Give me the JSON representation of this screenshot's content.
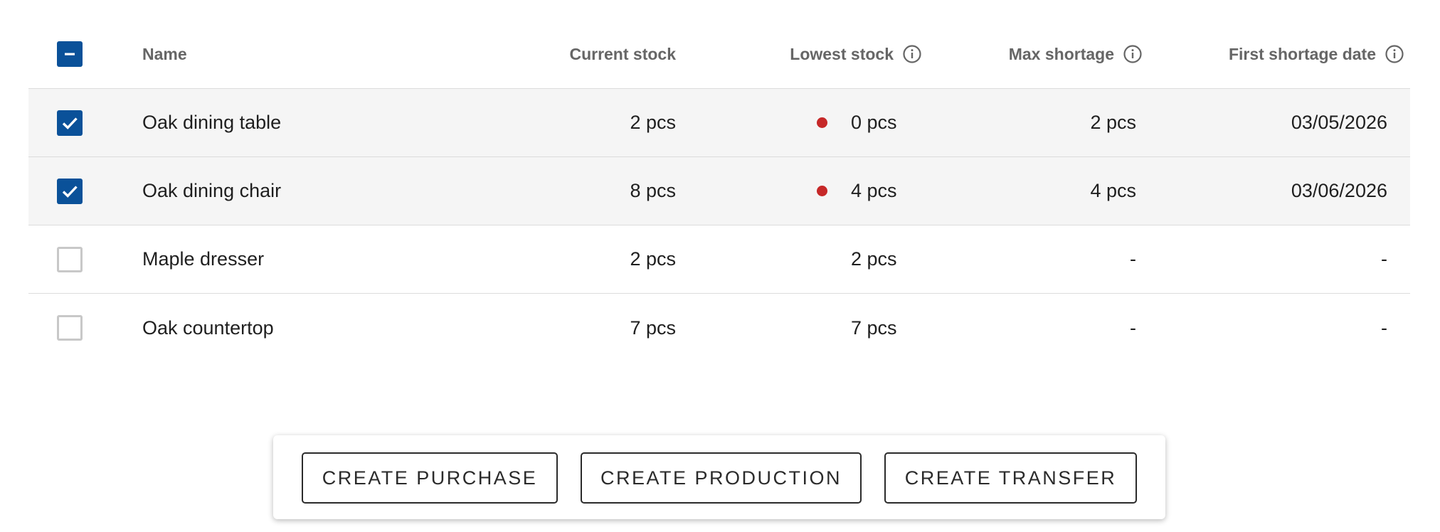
{
  "table": {
    "columns": {
      "name": "Name",
      "current_stock": "Current stock",
      "lowest_stock": "Lowest stock",
      "max_shortage": "Max shortage",
      "first_shortage_date": "First shortage date"
    },
    "header_checkbox_state": "indeterminate",
    "rows": [
      {
        "name": "Oak dining table",
        "current_stock": "2 pcs",
        "lowest_stock": "0 pcs",
        "max_shortage": "2 pcs",
        "first_shortage_date": "03/05/2026",
        "checked": true,
        "shortage": true
      },
      {
        "name": "Oak dining chair",
        "current_stock": "8 pcs",
        "lowest_stock": "4 pcs",
        "max_shortage": "4 pcs",
        "first_shortage_date": "03/06/2026",
        "checked": true,
        "shortage": true
      },
      {
        "name": "Maple dresser",
        "current_stock": "2 pcs",
        "lowest_stock": "2 pcs",
        "max_shortage": "-",
        "first_shortage_date": "-",
        "checked": false,
        "shortage": false
      },
      {
        "name": "Oak countertop",
        "current_stock": "7 pcs",
        "lowest_stock": "7 pcs",
        "max_shortage": "-",
        "first_shortage_date": "-",
        "checked": false,
        "shortage": false
      }
    ]
  },
  "actions": {
    "create_purchase": "CREATE PURCHASE",
    "create_production": "CREATE PRODUCTION",
    "create_transfer": "CREATE TRANSFER"
  },
  "icons": {
    "info": "info-circle-icon",
    "checkbox_checked": "check-icon",
    "checkbox_indeterminate": "minus-icon",
    "shortage_indicator": "red-dot-icon"
  },
  "colors": {
    "accent": "#0a5199",
    "shortage": "#c62828",
    "selected_row": "#f5f5f5"
  }
}
